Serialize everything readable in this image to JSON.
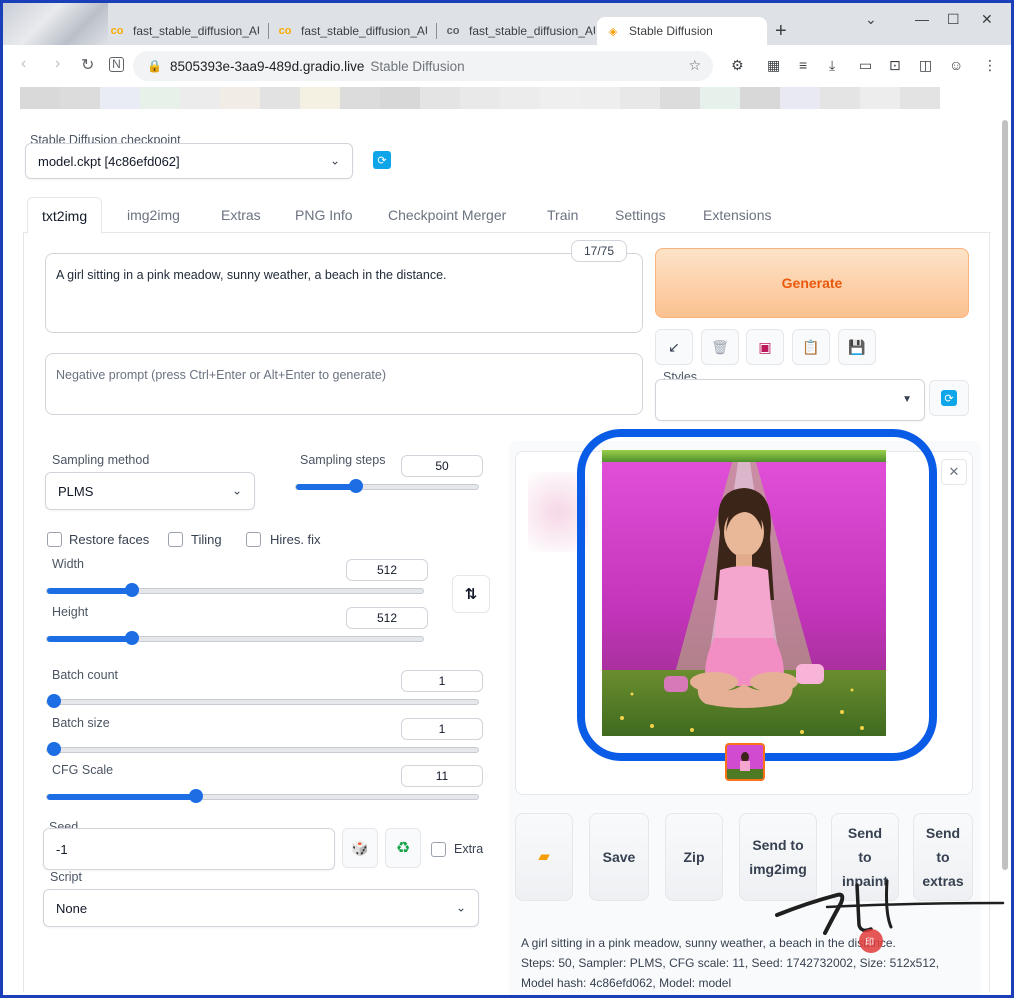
{
  "browser": {
    "tabs": [
      {
        "title": "fast_stable_diffusion_AU",
        "icon": "colab-icon",
        "active": false
      },
      {
        "title": "fast_stable_diffusion_AU",
        "icon": "colab-icon",
        "active": false
      },
      {
        "title": "fast_stable_diffusion_AU",
        "icon": "colab-icon",
        "active": false
      },
      {
        "title": "Stable Diffusion",
        "icon": "gradio-icon",
        "active": true
      }
    ],
    "url_host": "8505393e-3aa9-489d.gradio.live",
    "page_title": "Stable Diffusion"
  },
  "app": {
    "checkpoint_label": "Stable Diffusion checkpoint",
    "checkpoint_value": "model.ckpt [4c86efd062]",
    "tabs": [
      "txt2img",
      "img2img",
      "Extras",
      "PNG Info",
      "Checkpoint Merger",
      "Train",
      "Settings",
      "Extensions"
    ],
    "active_tab": "txt2img",
    "prompt": "A girl sitting in a pink meadow, sunny weather, a beach in the distance.",
    "token_counter": "17/75",
    "negative_placeholder": "Negative prompt (press Ctrl+Enter or Alt+Enter to generate)",
    "generate_label": "Generate",
    "styles_label": "Styles",
    "sampling_method_label": "Sampling method",
    "sampling_method_value": "PLMS",
    "sampling_steps_label": "Sampling steps",
    "sampling_steps_value": "50",
    "sampling_steps_max": 150,
    "checkboxes": [
      "Restore faces",
      "Tiling",
      "Hires. fix"
    ],
    "width_label": "Width",
    "width_value": "512",
    "height_label": "Height",
    "height_value": "512",
    "dimension_max": 2048,
    "batch_count_label": "Batch count",
    "batch_count_value": "1",
    "batch_size_label": "Batch size",
    "batch_size_value": "1",
    "cfg_label": "CFG Scale",
    "cfg_value": "11",
    "cfg_max": 30,
    "seed_label": "Seed",
    "seed_value": "-1",
    "extra_label": "Extra",
    "script_label": "Script",
    "script_value": "None",
    "action_buttons": [
      "Save",
      "Zip",
      "Send to img2img",
      "Send to inpaint",
      "Send to extras"
    ],
    "info_line1": "A girl sitting in a pink meadow, sunny weather, a beach in the distance.",
    "info_line2": "Steps: 50, Sampler: PLMS, CFG scale: 11, Seed: 1742732002, Size: 512x512,",
    "info_line3": "Model hash: 4c86efd062, Model: model"
  },
  "colors": {
    "accent_blue": "#1d6ee5",
    "highlight_blue": "#0a5ce6",
    "generate_orange": "#ea580c"
  }
}
